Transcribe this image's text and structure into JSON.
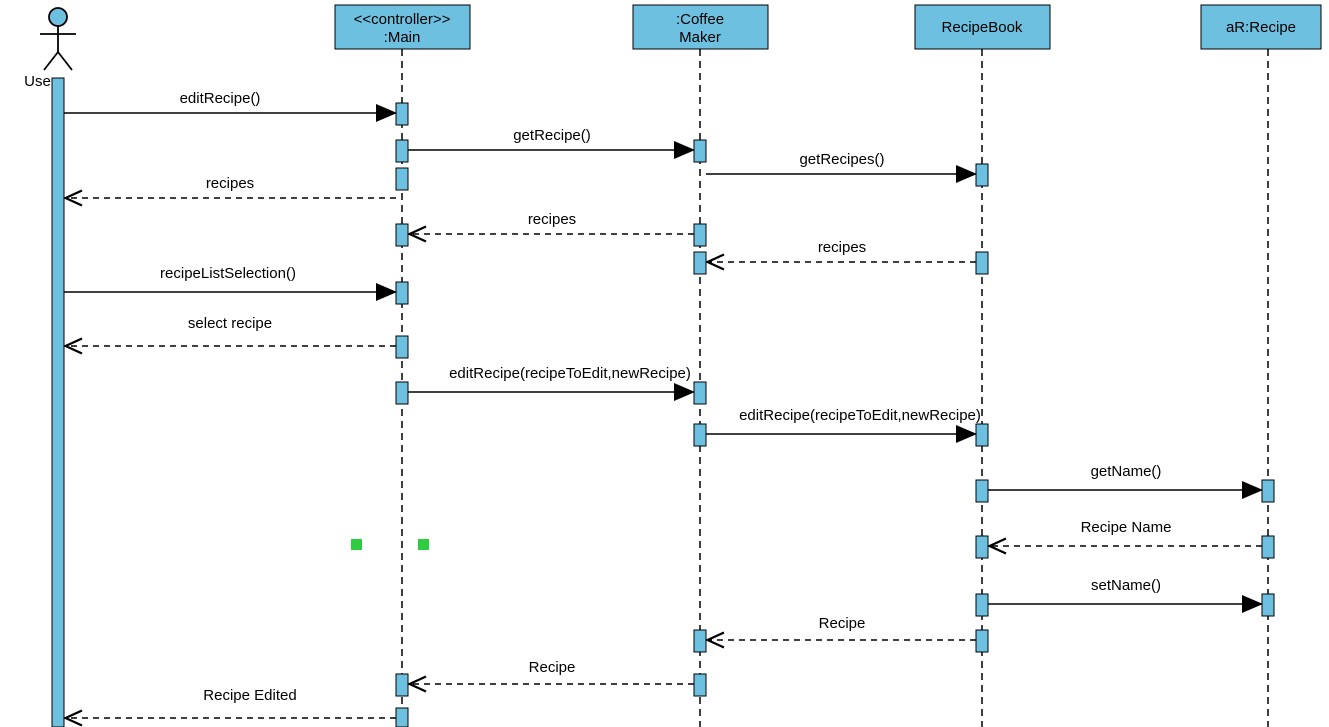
{
  "participants": {
    "user": "User",
    "main": [
      "<<controller>>",
      ":Main"
    ],
    "coffee": [
      ":Coffee",
      "Maker"
    ],
    "book": "RecipeBook",
    "recipe": "aR:Recipe"
  },
  "messages": {
    "m1": "editRecipe()",
    "m2": "getRecipe()",
    "m3": "getRecipes()",
    "m4": "recipes",
    "m5": "recipes",
    "m6": "recipes",
    "m7": "recipeListSelection()",
    "m8": "select recipe",
    "m9": "editRecipe(recipeToEdit,newRecipe)",
    "m10": "editRecipe(recipeToEdit,newRecipe)",
    "m11": "getName()",
    "m12": "Recipe Name",
    "m13": "setName()",
    "m14": "Recipe",
    "m15": "Recipe",
    "m16": "Recipe Edited"
  },
  "chart_data": {
    "type": "uml-sequence-diagram",
    "participants": [
      {
        "id": "User",
        "type": "actor"
      },
      {
        "id": ":Main",
        "stereotype": "<<controller>>",
        "type": "object"
      },
      {
        "id": ":CoffeeMaker",
        "type": "object"
      },
      {
        "id": "RecipeBook",
        "type": "object"
      },
      {
        "id": "aR:Recipe",
        "type": "object"
      }
    ],
    "messages": [
      {
        "from": "User",
        "to": ":Main",
        "label": "editRecipe()",
        "type": "call"
      },
      {
        "from": ":Main",
        "to": ":CoffeeMaker",
        "label": "getRecipe()",
        "type": "call"
      },
      {
        "from": ":CoffeeMaker",
        "to": "RecipeBook",
        "label": "getRecipes()",
        "type": "call"
      },
      {
        "from": ":Main",
        "to": "User",
        "label": "recipes",
        "type": "return"
      },
      {
        "from": ":CoffeeMaker",
        "to": ":Main",
        "label": "recipes",
        "type": "return"
      },
      {
        "from": "RecipeBook",
        "to": ":CoffeeMaker",
        "label": "recipes",
        "type": "return"
      },
      {
        "from": "User",
        "to": ":Main",
        "label": "recipeListSelection()",
        "type": "call"
      },
      {
        "from": ":Main",
        "to": "User",
        "label": "select recipe",
        "type": "return"
      },
      {
        "from": ":Main",
        "to": ":CoffeeMaker",
        "label": "editRecipe(recipeToEdit,newRecipe)",
        "type": "call"
      },
      {
        "from": ":CoffeeMaker",
        "to": "RecipeBook",
        "label": "editRecipe(recipeToEdit,newRecipe)",
        "type": "call"
      },
      {
        "from": "RecipeBook",
        "to": "aR:Recipe",
        "label": "getName()",
        "type": "call"
      },
      {
        "from": "aR:Recipe",
        "to": "RecipeBook",
        "label": "Recipe Name",
        "type": "return"
      },
      {
        "from": "RecipeBook",
        "to": "aR:Recipe",
        "label": "setName()",
        "type": "call"
      },
      {
        "from": "RecipeBook",
        "to": ":CoffeeMaker",
        "label": "Recipe",
        "type": "return"
      },
      {
        "from": ":CoffeeMaker",
        "to": ":Main",
        "label": "Recipe",
        "type": "return"
      },
      {
        "from": ":Main",
        "to": "User",
        "label": "Recipe Edited",
        "type": "return"
      }
    ]
  }
}
